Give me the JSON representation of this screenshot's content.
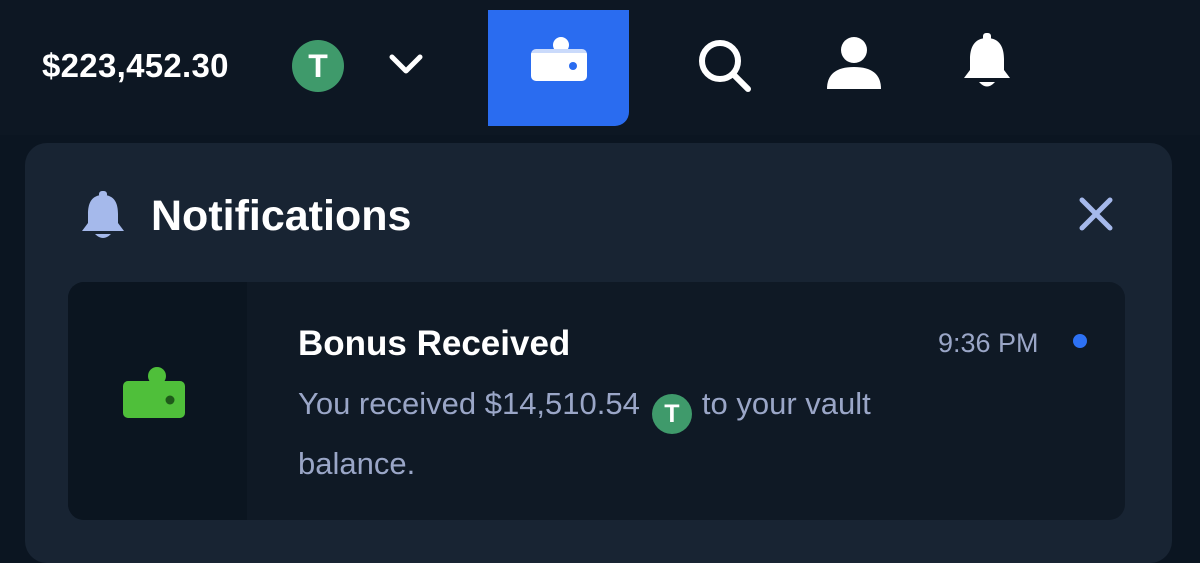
{
  "header": {
    "balance": "$223,452.30",
    "currency_symbol": "T",
    "currency_color": "#3f9a6b",
    "accent_color": "#2a6cf0",
    "icons": [
      "chevron-down-icon",
      "wallet-icon",
      "search-icon",
      "user-icon",
      "bell-icon"
    ]
  },
  "panel": {
    "title": "Notifications",
    "icons": [
      "bell-icon",
      "close-icon"
    ]
  },
  "notifications": [
    {
      "icon": "wallet-icon",
      "icon_color": "#4fbf3a",
      "title": "Bonus Received",
      "time": "9:36 PM",
      "unread": true,
      "message_before": "You received $14,510.54",
      "token_symbol": "T",
      "message_after": "to your vault",
      "message_line2": "balance."
    }
  ]
}
